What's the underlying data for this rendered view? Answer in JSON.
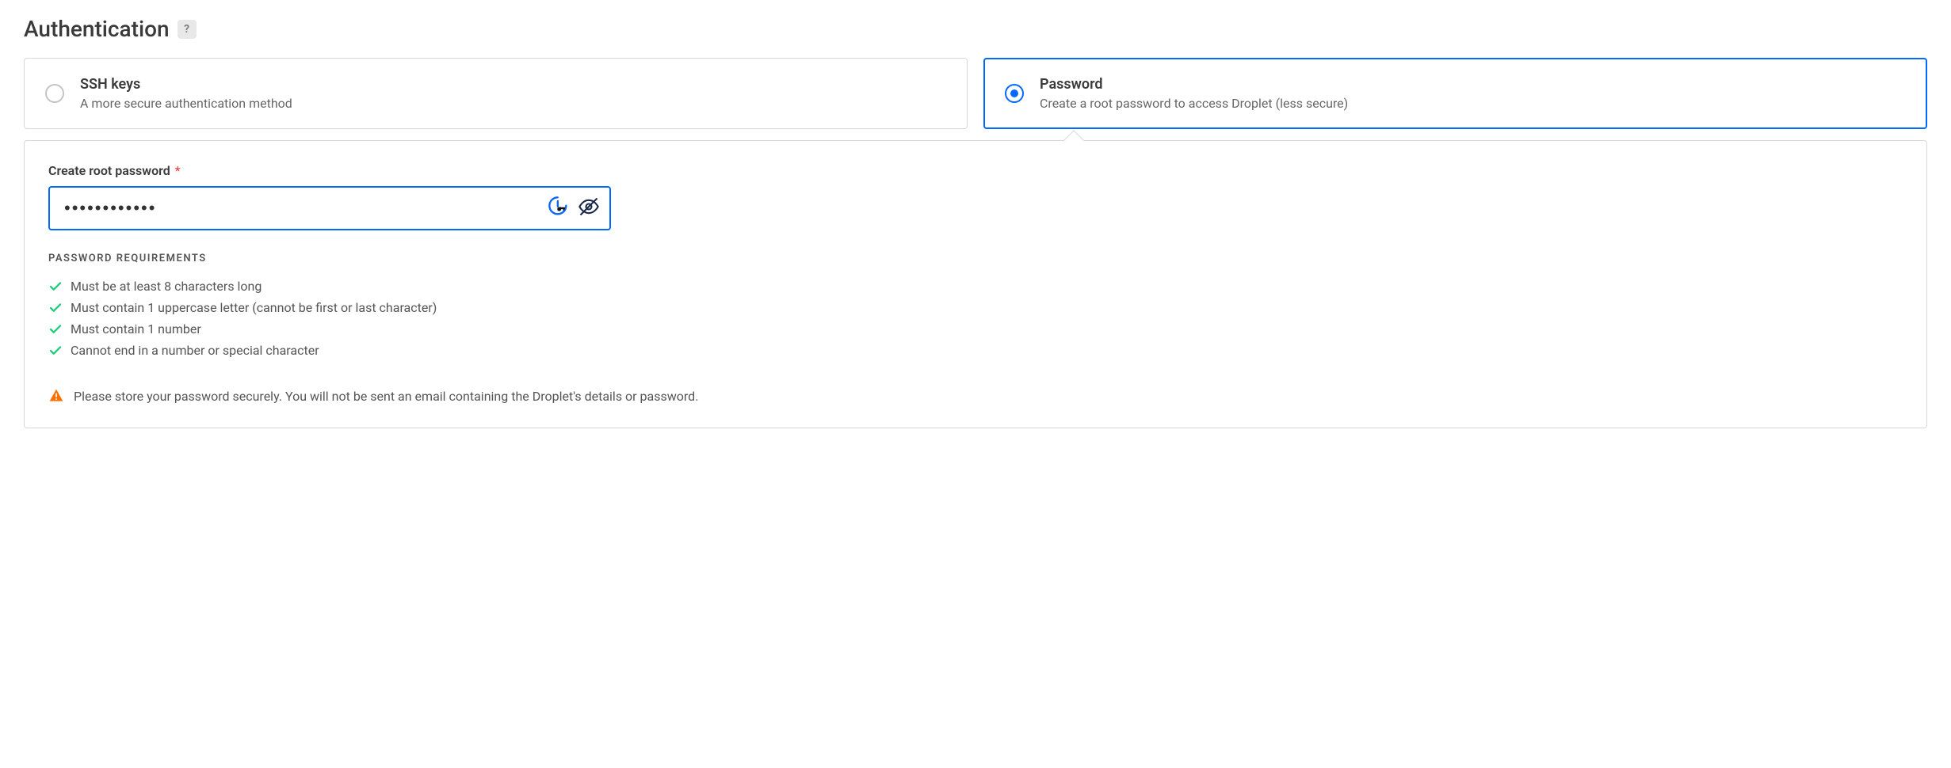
{
  "section": {
    "title": "Authentication",
    "help": "?"
  },
  "options": {
    "ssh": {
      "title": "SSH keys",
      "desc": "A more secure authentication method"
    },
    "password": {
      "title": "Password",
      "desc": "Create a root password to access Droplet (less secure)"
    }
  },
  "field": {
    "label": "Create root password",
    "required": "*",
    "value": "••••••••••••"
  },
  "requirements": {
    "heading": "PASSWORD REQUIREMENTS",
    "items": [
      "Must be at least 8 characters long",
      "Must contain 1 uppercase letter (cannot be first or last character)",
      "Must contain 1 number",
      "Cannot end in a number or special character"
    ]
  },
  "warning": "Please store your password securely. You will not be sent an email containing the Droplet's details or password."
}
